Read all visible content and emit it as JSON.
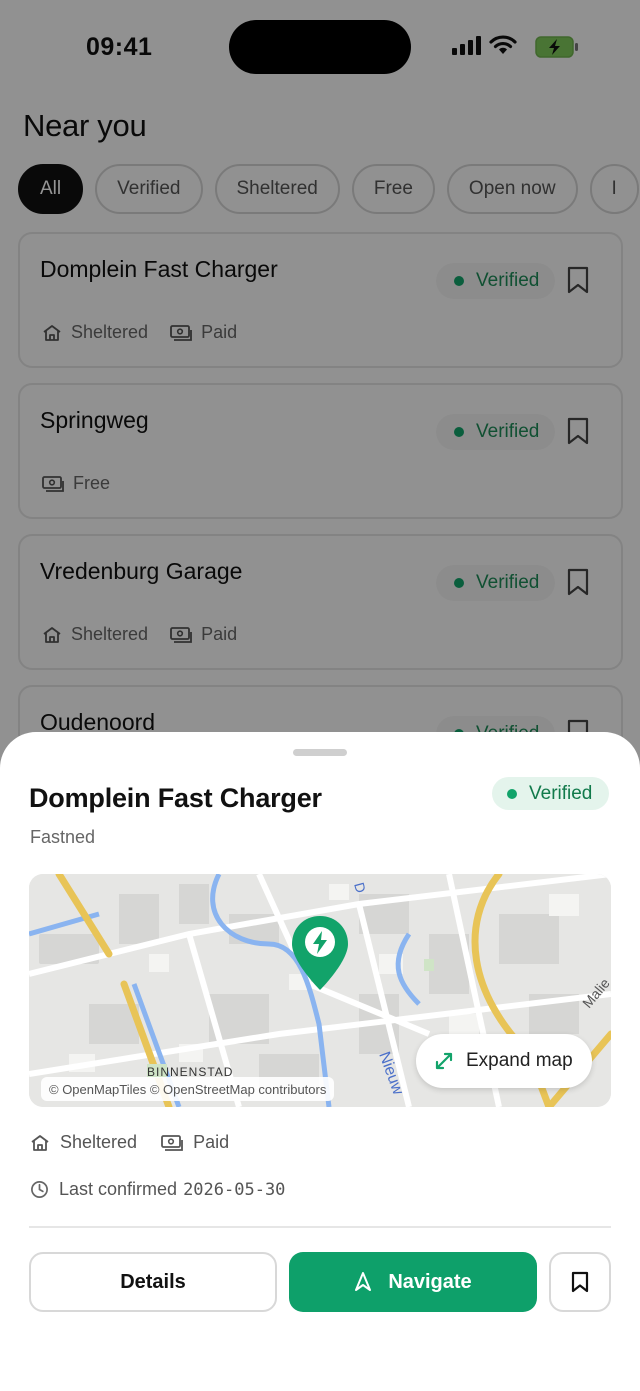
{
  "status_bar": {
    "time": "09:41"
  },
  "list": {
    "title": "Near you",
    "filters": [
      "All",
      "Verified",
      "Sheltered",
      "Free",
      "Open now",
      "I"
    ],
    "active_filter": "All",
    "cards": [
      {
        "name": "Domplein Fast Charger",
        "badge": "Verified",
        "meta": [
          {
            "icon": "house-icon",
            "label": "Sheltered"
          },
          {
            "icon": "cash-icon",
            "label": "Paid"
          }
        ]
      },
      {
        "name": "Springweg",
        "badge": "Verified",
        "meta": [
          {
            "icon": "cash-icon",
            "label": "Free"
          }
        ]
      },
      {
        "name": "Vredenburg Garage",
        "badge": "Verified",
        "meta": [
          {
            "icon": "house-icon",
            "label": "Sheltered"
          },
          {
            "icon": "cash-icon",
            "label": "Paid"
          }
        ]
      },
      {
        "name": "Oudenoord",
        "badge": "Verified",
        "meta": []
      }
    ]
  },
  "sheet": {
    "title": "Domplein Fast Charger",
    "subtitle": "Fastned",
    "badge": "Verified",
    "map": {
      "attribution": "© OpenMapTiles © OpenStreetMap contributors",
      "expand_label": "Expand map",
      "street_labels": [
        "BINNENSTAD",
        "Nieuw",
        "Malie",
        "D"
      ]
    },
    "shelter_label": "Sheltered",
    "payment_label": "Paid",
    "last_confirmed_label": "Last confirmed",
    "last_confirmed_date": "2026-05-30",
    "details_label": "Details",
    "navigate_label": "Navigate"
  },
  "colors": {
    "accent": "#0ea06a",
    "verified_text": "#117a4b",
    "verified_bg": "#e4f4ec"
  }
}
